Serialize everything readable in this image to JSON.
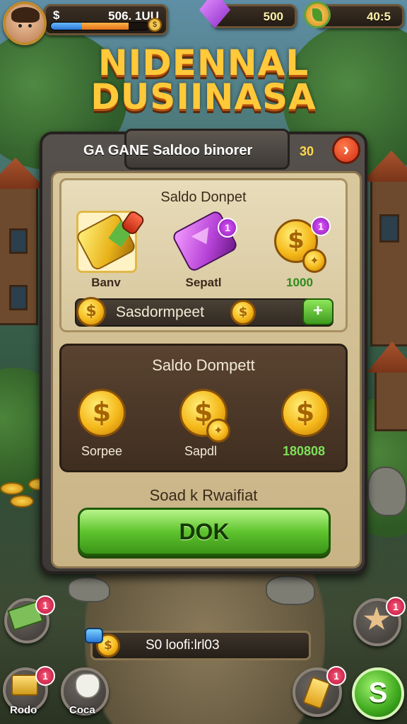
{
  "hud": {
    "currency_symbol": "$",
    "balance": "506. 1UU",
    "progress_blue": 0.32,
    "progress_orange": 0.48,
    "gems": "500",
    "energy": "40:5"
  },
  "title": {
    "line1": "NIDENNAL",
    "line2": "DUSIINASA"
  },
  "panel": {
    "header_title": "GA GANE Saldoo binorer",
    "header_count": "30",
    "close_glyph": "›",
    "card1": {
      "title": "Saldo Donpet",
      "items": [
        {
          "label": "Banv",
          "badge": ""
        },
        {
          "label": "Sepatl",
          "badge": "1"
        },
        {
          "label": "1000",
          "badge": "1"
        }
      ],
      "balance_label": "Sasdormpeet",
      "plus_label": "+"
    },
    "card2": {
      "title": "Saldo Dompett",
      "items": [
        {
          "label": "Sorpee"
        },
        {
          "label": "Sapdl"
        },
        {
          "label": "180808"
        }
      ]
    },
    "footer_label": "Soad k Rwaifiat",
    "ok_label": "DOK"
  },
  "bottom": {
    "left_top_badge": "1",
    "left_bottom_label": "Rodo",
    "left_bottom_badge": "1",
    "bag_label": "Coca",
    "bar_text": "S0   loofi:lrl03",
    "right_top_badge": "1",
    "ticket_badge": "1",
    "green_label": "S"
  },
  "colors": {
    "accent_green": "#5fc42e",
    "gold": "#f5b81a",
    "badge_red": "#b4123a",
    "title_orange": "#ffc93a"
  },
  "icons": [
    "avatar",
    "gem-icon",
    "leaf-coin-icon",
    "close-chevron-icon",
    "gold-bar-icon",
    "purple-gift-icon",
    "coin-icon",
    "plus-icon",
    "cash-icon",
    "gold-stack-icon",
    "bag-icon",
    "star-icon",
    "ticket-icon"
  ]
}
